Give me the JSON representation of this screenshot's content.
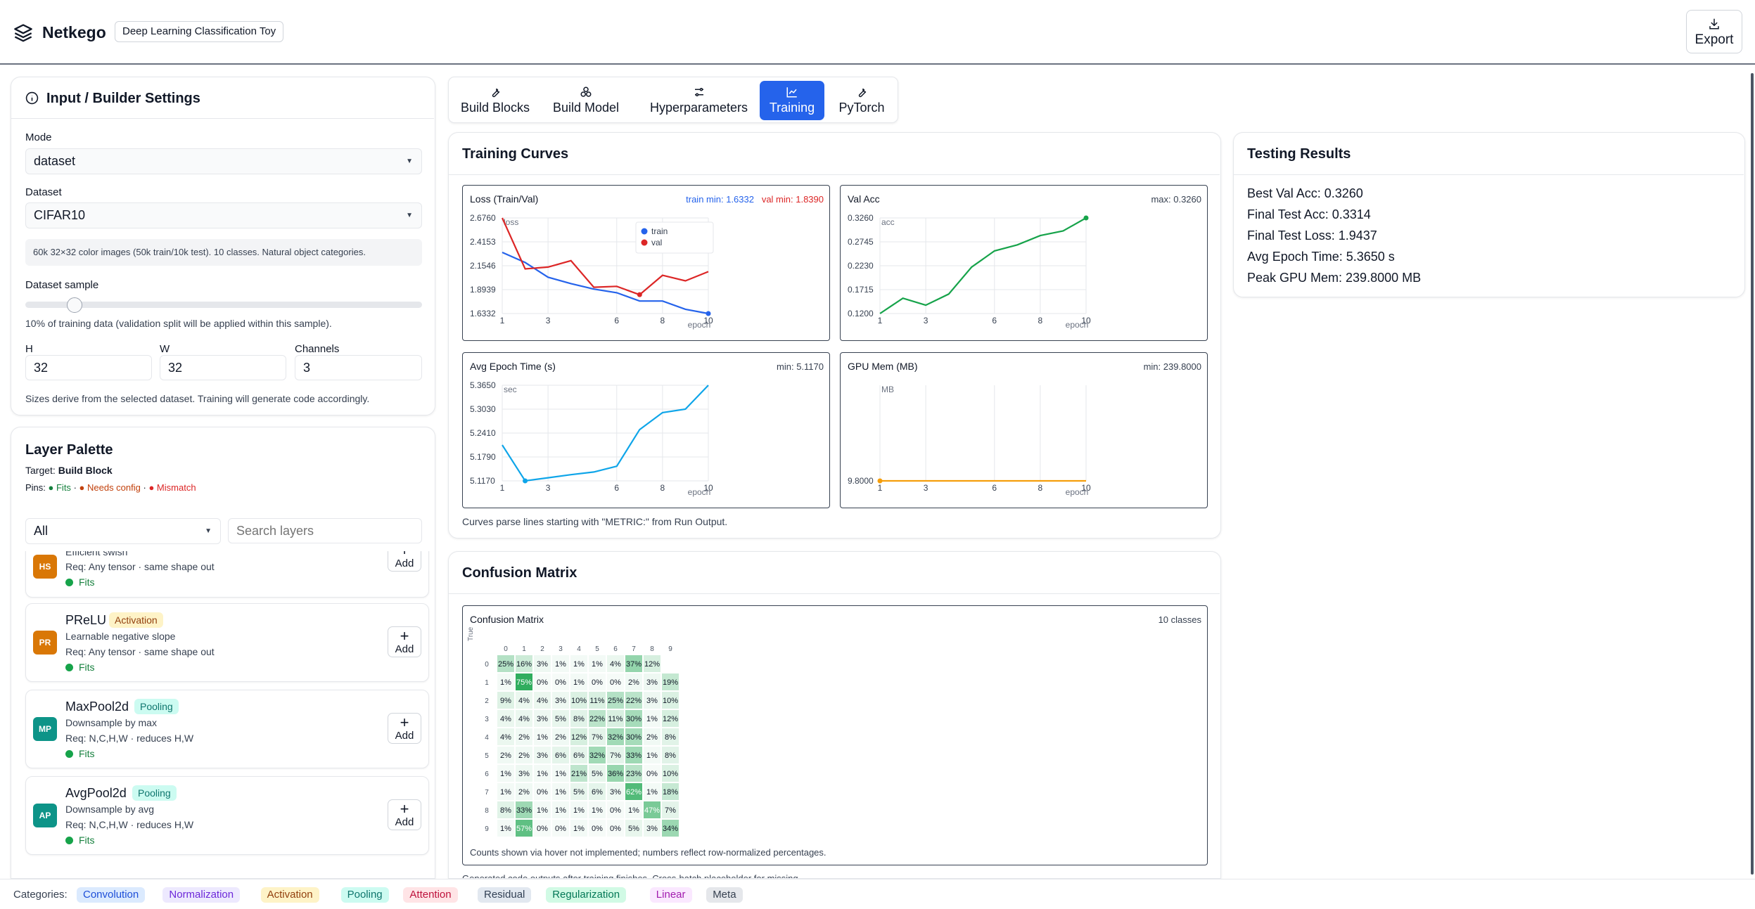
{
  "app": {
    "name": "Netkego",
    "subtitle": "Deep Learning Classification Toy",
    "export_label": "Export"
  },
  "input_panel": {
    "title": "Input / Builder Settings",
    "mode_label": "Mode",
    "mode_value": "dataset",
    "dataset_label": "Dataset",
    "dataset_value": "CIFAR10",
    "dataset_desc": "60k 32×32 color images (50k train/10k test). 10 classes. Natural object categories.",
    "sample_label": "Dataset sample",
    "sample_fraction": 0.1,
    "sample_note": "10% of training data (validation split will be applied within this sample).",
    "h_label": "H",
    "h_value": "32",
    "w_label": "W",
    "w_value": "32",
    "c_label": "Channels",
    "c_value": "3",
    "sizes_note": "Sizes derive from the selected dataset. Training will generate code accordingly."
  },
  "palette": {
    "title": "Layer Palette",
    "target_prefix": "Target:",
    "target_value": "Build Block",
    "pins_prefix": "Pins:",
    "pin_fits": "● Fits",
    "pin_sep1": "·",
    "pin_needs": "● Needs config",
    "pin_sep2": "·",
    "pin_mismatch": "● Mismatch",
    "filter_value": "All",
    "search_placeholder": "Search layers",
    "items": [
      {
        "abbr": "HS",
        "name": "",
        "badge": "",
        "desc": "Efficient swish",
        "req": "Req: Any tensor · same shape out",
        "status": "Fits",
        "add": "Add"
      },
      {
        "abbr": "PR",
        "name": "PReLU",
        "badge": "Activation",
        "desc": "Learnable negative slope",
        "req": "Req: Any tensor · same shape out",
        "status": "Fits",
        "add": "Add"
      },
      {
        "abbr": "MP",
        "name": "MaxPool2d",
        "badge": "Pooling",
        "desc": "Downsample by max",
        "req": "Req: N,C,H,W · reduces H,W",
        "status": "Fits",
        "add": "Add"
      },
      {
        "abbr": "AP",
        "name": "AvgPool2d",
        "badge": "Pooling",
        "desc": "Downsample by avg",
        "req": "Req: N,C,H,W · reduces H,W",
        "status": "Fits",
        "add": "Add"
      }
    ]
  },
  "tabs": [
    {
      "label": "Build Blocks",
      "icon": "wrench-icon"
    },
    {
      "label": "Build Model",
      "icon": "blocks-icon"
    },
    {
      "label": "Hyperparameters",
      "icon": "sliders-icon"
    },
    {
      "label": "Training",
      "icon": "line-chart-icon",
      "active": true
    },
    {
      "label": "PyTorch",
      "icon": "wrench-icon"
    }
  ],
  "training_curves": {
    "title": "Training Curves",
    "note": "Curves parse lines starting with \"METRIC:\" from Run Output.",
    "loss_title": "Loss (Train/Val)",
    "loss_train_meta": "train min: 1.6332",
    "loss_val_meta": "val min: 1.8390",
    "acc_title": "Val Acc",
    "acc_meta": "max: 0.3260",
    "time_title": "Avg Epoch Time (s)",
    "time_meta": "min: 5.1170",
    "mem_title": "GPU Mem (MB)",
    "mem_meta": "min: 239.8000"
  },
  "testing": {
    "title": "Testing Results",
    "lines": [
      "Best Val Acc: 0.3260",
      "Final Test Acc: 0.3314",
      "Final Test Loss: 1.9437",
      "Avg Epoch Time: 5.3650 s",
      "Peak GPU Mem: 239.8000 MB"
    ]
  },
  "confusion": {
    "title": "Confusion Matrix",
    "box_title": "Confusion Matrix",
    "classes_label": "10 classes",
    "note": "Counts shown via hover not implemented; numbers reflect row-normalized percentages.",
    "truncated_note": "Generated code outputs after training finishes. Cross-hatch placeholder for missing",
    "ylabel": "True",
    "labels": [
      "0",
      "1",
      "2",
      "3",
      "4",
      "5",
      "6",
      "7",
      "8",
      "9"
    ],
    "matrix": [
      [
        25,
        16,
        3,
        1,
        1,
        1,
        4,
        37,
        12,
        null
      ],
      [
        1,
        75,
        0,
        0,
        1,
        0,
        0,
        2,
        3,
        19
      ],
      [
        9,
        4,
        4,
        3,
        10,
        11,
        25,
        22,
        3,
        10
      ],
      [
        4,
        4,
        3,
        5,
        8,
        22,
        11,
        30,
        1,
        12
      ],
      [
        4,
        2,
        1,
        2,
        12,
        7,
        32,
        30,
        2,
        8
      ],
      [
        2,
        2,
        3,
        6,
        6,
        32,
        7,
        33,
        1,
        8
      ],
      [
        1,
        3,
        1,
        1,
        21,
        5,
        36,
        23,
        0,
        10
      ],
      [
        1,
        2,
        0,
        1,
        5,
        6,
        3,
        62,
        1,
        18
      ],
      [
        8,
        33,
        1,
        1,
        1,
        1,
        0,
        1,
        47,
        7
      ],
      [
        1,
        57,
        0,
        0,
        1,
        0,
        0,
        5,
        3,
        34
      ]
    ]
  },
  "chart_data": [
    {
      "type": "line",
      "title": "Loss (Train/Val)",
      "xlabel": "epoch",
      "ylabel": "loss",
      "x": [
        1,
        2,
        3,
        4,
        5,
        6,
        7,
        8,
        9,
        10
      ],
      "xticks": [
        1,
        3,
        6,
        8,
        10
      ],
      "yticks": [
        "2.6760",
        "2.4153",
        "2.1546",
        "1.8939",
        "1.6332"
      ],
      "ylim": [
        1.6332,
        2.676
      ],
      "legend": "top-center",
      "series": [
        {
          "name": "train",
          "color": "#2563eb",
          "values": [
            2.3,
            2.19,
            2.03,
            1.96,
            1.9,
            1.86,
            1.77,
            1.77,
            1.68,
            1.6332
          ]
        },
        {
          "name": "val",
          "color": "#dc2626",
          "values": [
            2.676,
            2.12,
            2.14,
            2.21,
            1.92,
            1.93,
            1.839,
            2.05,
            1.99,
            2.09
          ]
        }
      ]
    },
    {
      "type": "line",
      "title": "Val Acc",
      "xlabel": "epoch",
      "ylabel": "acc",
      "x": [
        1,
        2,
        3,
        4,
        5,
        6,
        7,
        8,
        9,
        10
      ],
      "xticks": [
        1,
        3,
        6,
        8,
        10
      ],
      "yticks": [
        "0.3260",
        "0.2745",
        "0.2230",
        "0.1715",
        "0.1200"
      ],
      "ylim": [
        0.12,
        0.326
      ],
      "series": [
        {
          "name": "",
          "color": "#16a34a",
          "values": [
            0.12,
            0.153,
            0.138,
            0.162,
            0.22,
            0.255,
            0.268,
            0.288,
            0.298,
            0.326
          ]
        }
      ]
    },
    {
      "type": "line",
      "title": "Avg Epoch Time (s)",
      "xlabel": "epoch",
      "ylabel": "sec",
      "x": [
        1,
        2,
        3,
        4,
        5,
        6,
        7,
        8,
        9,
        10
      ],
      "xticks": [
        1,
        3,
        6,
        8,
        10
      ],
      "yticks": [
        "5.3650",
        "5.3030",
        "5.2410",
        "5.1790",
        "5.1170"
      ],
      "ylim": [
        5.117,
        5.365
      ],
      "series": [
        {
          "name": "",
          "color": "#0ea5e9",
          "values": [
            5.21,
            5.117,
            5.125,
            5.133,
            5.14,
            5.155,
            5.25,
            5.294,
            5.303,
            5.365
          ]
        }
      ]
    },
    {
      "type": "line",
      "title": "GPU Mem (MB)",
      "xlabel": "epoch",
      "ylabel": "MB",
      "x": [
        1,
        2,
        3,
        4,
        5,
        6,
        7,
        8,
        9,
        10
      ],
      "xticks": [
        1,
        3,
        6,
        8,
        10
      ],
      "yticks": [
        "9.8000"
      ],
      "ylim": [
        9.8,
        9.8
      ],
      "series": [
        {
          "name": "",
          "color": "#f59e0b",
          "values": [
            9.8,
            9.8,
            9.8,
            9.8,
            9.8,
            9.8,
            9.8,
            9.8,
            9.8,
            9.8
          ]
        }
      ]
    }
  ],
  "footer": {
    "label": "Categories:",
    "chips": [
      {
        "label": "Convolution",
        "bg": "#dbeafe",
        "fg": "#1d4ed8"
      },
      {
        "label": "Normalization",
        "bg": "#ede9fe",
        "fg": "#6d28d9"
      },
      {
        "label": "Activation",
        "bg": "#fef3c7",
        "fg": "#92400e"
      },
      {
        "label": "Pooling",
        "bg": "#ccfbf1",
        "fg": "#0f766e"
      },
      {
        "label": "Attention",
        "bg": "#ffe4e6",
        "fg": "#be123c"
      },
      {
        "label": "Residual",
        "bg": "#e2e8f0",
        "fg": "#334155"
      },
      {
        "label": "Regularization",
        "bg": "#d1fae5",
        "fg": "#047857"
      },
      {
        "label": "Linear",
        "bg": "#fae8ff",
        "fg": "#a21caf"
      },
      {
        "label": "Meta",
        "bg": "#e5e7eb",
        "fg": "#374151"
      }
    ]
  },
  "colors": {
    "accent": "#2563eb",
    "fits": "#16a34a",
    "needs": "#ea580c",
    "mismatch": "#dc2626",
    "avatar_activation": "#d97706",
    "avatar_pooling": "#0d9488"
  }
}
